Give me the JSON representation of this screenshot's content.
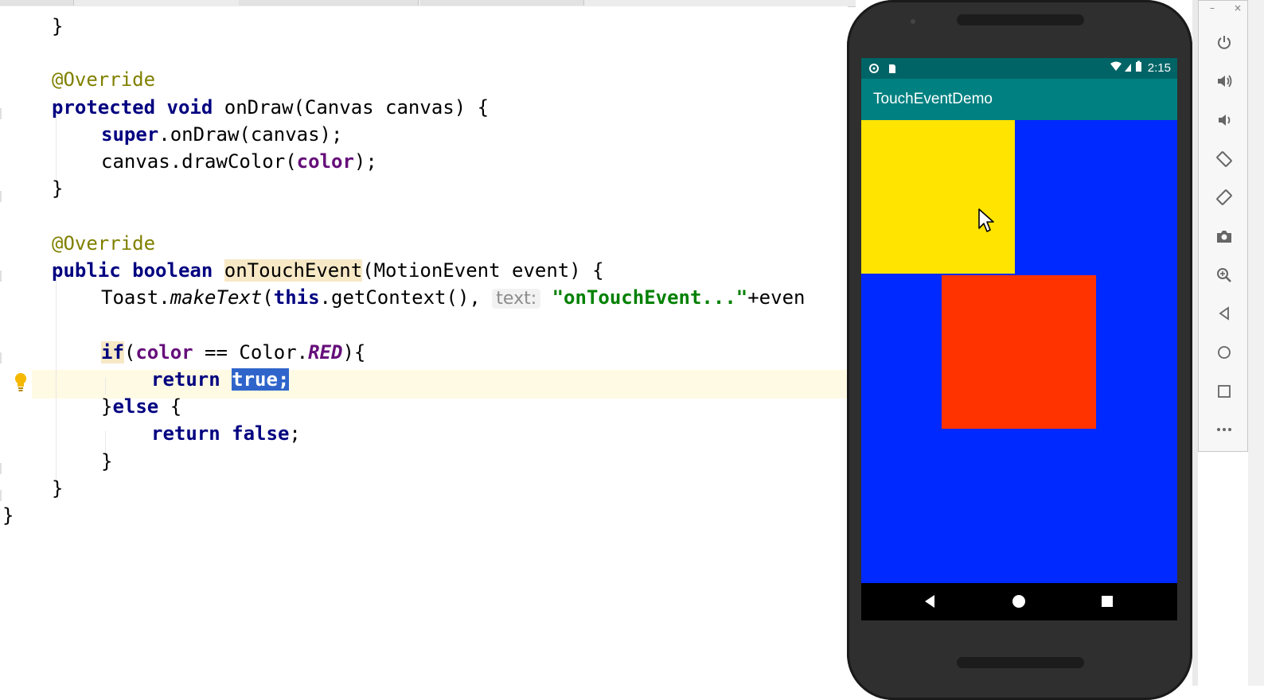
{
  "editor": {
    "lines": {
      "l1": {
        "brace": "}"
      },
      "l2": {
        "annotation": "@Override"
      },
      "l3": {
        "kw1": "protected",
        "kw2": "void",
        "rest": " onDraw(Canvas canvas) {"
      },
      "l4": {
        "kw": "super",
        "rest": ".onDraw(canvas);"
      },
      "l5": {
        "pre": "canvas.drawColor(",
        "field": "color",
        "post": ");"
      },
      "l6": {
        "brace": "}"
      },
      "l7": {
        "annotation": "@Override"
      },
      "l8": {
        "kw1": "public",
        "kw2": "boolean",
        "method": "onTouchEvent",
        "rest": "(MotionEvent event) {"
      },
      "l9": {
        "pre": "Toast.",
        "method_italic": "makeText",
        "open": "(",
        "kw": "this",
        "mid": ".getContext(), ",
        "hint": "text:",
        "string": "\"onTouchEvent...\"",
        "post": "+even"
      },
      "l10": {
        "kw": "if",
        "open": "(",
        "field": "color",
        "mid": " == Color.",
        "const": "RED",
        "post": "){"
      },
      "l11": {
        "kw": "return",
        "selected": "true;"
      },
      "l12": {
        "pre": "}",
        "kw": "else",
        "post": " {"
      },
      "l13": {
        "kw": "return",
        "kw2": "false",
        "post": ";"
      },
      "l14": {
        "brace": "}"
      },
      "l15": {
        "brace": "}"
      },
      "l16": {
        "brace": "}"
      }
    },
    "icons": {
      "intention": "lightbulb-icon"
    },
    "colors": {
      "keyword": "#000080",
      "annotation": "#808000",
      "field": "#660e7a",
      "string": "#008000",
      "selection": "#2f65ca",
      "caret_row": "#fffae3"
    }
  },
  "emulator": {
    "status_time": "2:15",
    "app_title": "TouchEventDemo",
    "colors": {
      "background": "#0029ff",
      "yellow_view": "#ffe400",
      "red_view": "#ff3300",
      "appbar": "#008080",
      "statusbar": "#006466"
    },
    "nav": [
      "back-icon",
      "home-icon",
      "recents-icon"
    ]
  },
  "toolbar": {
    "window_buttons": {
      "minimize": "–",
      "close": "×"
    },
    "tools": [
      "power-icon",
      "volume-up-icon",
      "volume-down-icon",
      "rotate-left-icon",
      "rotate-right-icon",
      "camera-icon",
      "zoom-icon",
      "back-icon",
      "home-icon",
      "overview-icon",
      "more-icon"
    ]
  }
}
